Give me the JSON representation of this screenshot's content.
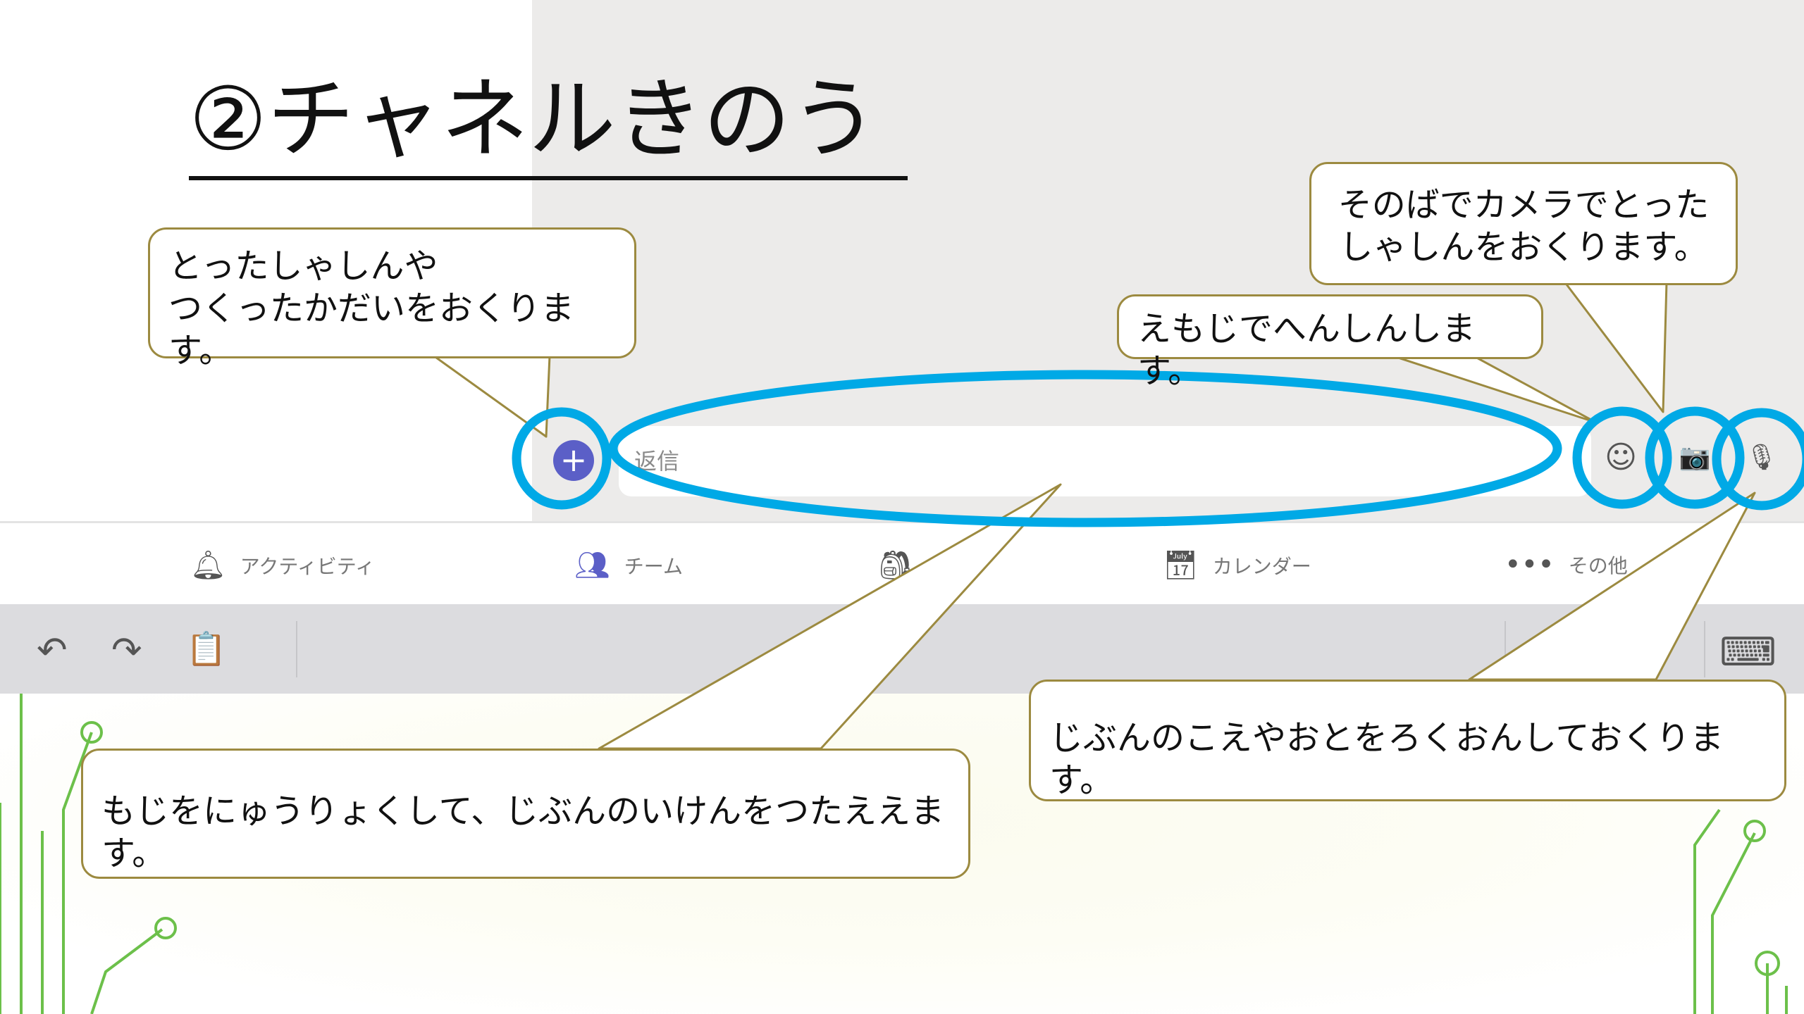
{
  "slide": {
    "title": "②チャネルきのう"
  },
  "compose": {
    "placeholder": "返信",
    "plus_icon": "+",
    "emoji_icon": "☺",
    "camera_icon": "📷",
    "mic_icon": "🎙"
  },
  "nav": {
    "items": [
      {
        "label": "アクティビティ",
        "icon": "bell-icon"
      },
      {
        "label": "チーム",
        "icon": "teams-icon"
      },
      {
        "label": "",
        "icon": "assignments-icon"
      },
      {
        "label": "カレンダー",
        "icon": "calendar-icon"
      },
      {
        "label": "その他",
        "icon": "more-icon"
      }
    ]
  },
  "toolbar": {
    "undo_icon": "↶",
    "redo_icon": "↷",
    "clipboard_icon": "📋",
    "keyboard_icon": "⌨"
  },
  "callouts": {
    "attach": "とったしゃしんや\nつくったかだいをおくります。",
    "camera": "そのばでカメラでとった\nしゃしんをおくります。",
    "emoji": "えもじでへんしんします。",
    "text": "もじをにゅうりょくして、じぶんのいけんをつたええます。",
    "voice": "じぶんのこえやおとをろくおんしておくります。"
  },
  "colors": {
    "highlight": "#00a9e6",
    "callout_border": "#9c8a40",
    "teams_purple": "#5b5fc7",
    "circuit_green": "#6cc04a"
  }
}
